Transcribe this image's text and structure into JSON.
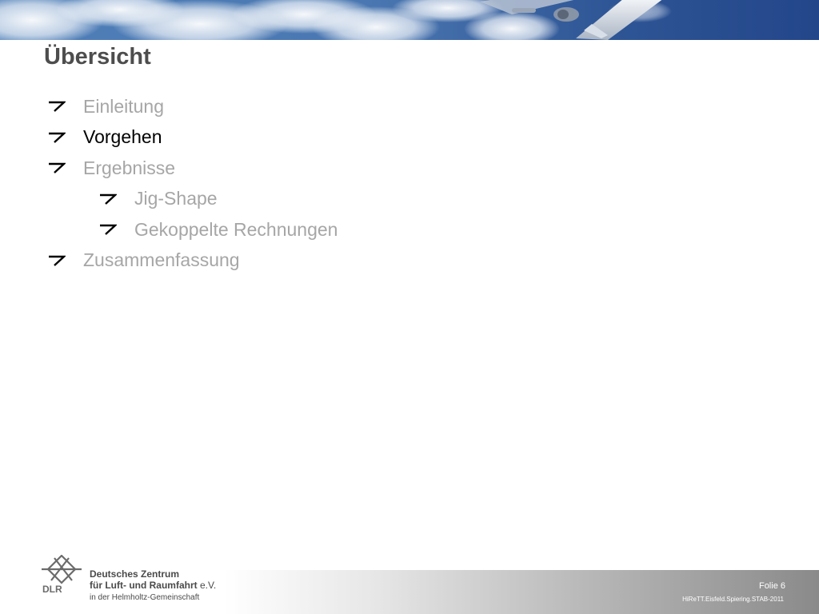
{
  "slide": {
    "title": "Übersicht",
    "agenda": [
      {
        "label": "Einleitung",
        "level": 1,
        "state": "inactive"
      },
      {
        "label": "Vorgehen",
        "level": 1,
        "state": "current"
      },
      {
        "label": "Ergebnisse",
        "level": 1,
        "state": "inactive"
      },
      {
        "label": "Jig-Shape",
        "level": 2,
        "state": "inactive"
      },
      {
        "label": "Gekoppelte Rechnungen",
        "level": 2,
        "state": "inactive"
      },
      {
        "label": "Zusammenfassung",
        "level": 1,
        "state": "inactive"
      }
    ]
  },
  "footer": {
    "logo_text": "DLR",
    "org_line1": "Deutsches Zentrum",
    "org_line2": "für Luft- und Raumfahrt",
    "org_line2_suffix": "e.V.",
    "org_sub": "in der Helmholtz-Gemeinschaft",
    "page_label": "Folie 6",
    "doc_ref": "HiReTT.Eisfeld.Spiering.STAB-2011"
  },
  "colors": {
    "title": "#4d4d4d",
    "current_item": "#000000",
    "inactive_item": "#a6a6a6",
    "banner_sky": "#2f5a9a"
  },
  "icons": {
    "bullet": "arrow-bullet-icon",
    "banner": "aircraft-sky-banner",
    "logo": "dlr-logo-icon"
  }
}
